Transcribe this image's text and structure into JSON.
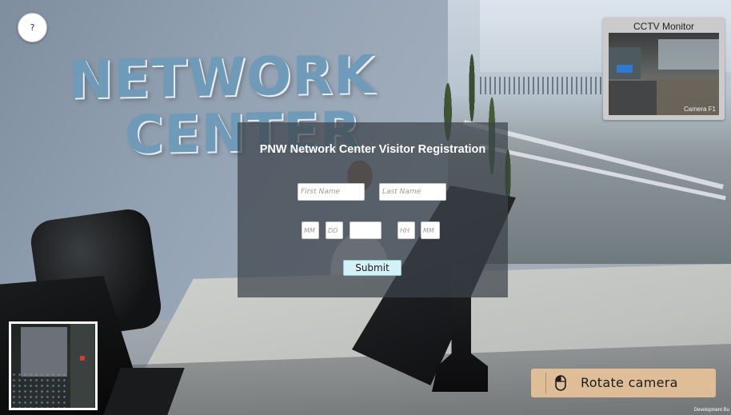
{
  "scene": {
    "wall_sign_line1": "NETWORK",
    "wall_sign_line2": "CENTER"
  },
  "help_button": {
    "label": "?"
  },
  "cctv": {
    "title": "CCTV Monitor",
    "camera_label": "Camera F1"
  },
  "registration": {
    "title": "PNW Network Center Visitor Registration",
    "first_name_placeholder": "First Name",
    "last_name_placeholder": "Last Name",
    "month_placeholder": "MM",
    "day_placeholder": "DD",
    "year_placeholder": "",
    "hour_placeholder": "HH",
    "minute_placeholder": "MM",
    "submit_label": "Submit"
  },
  "hint": {
    "rotate_label": "Rotate camera",
    "icon": "mouse-icon"
  },
  "footer": {
    "dev_build": "Development Bu"
  }
}
